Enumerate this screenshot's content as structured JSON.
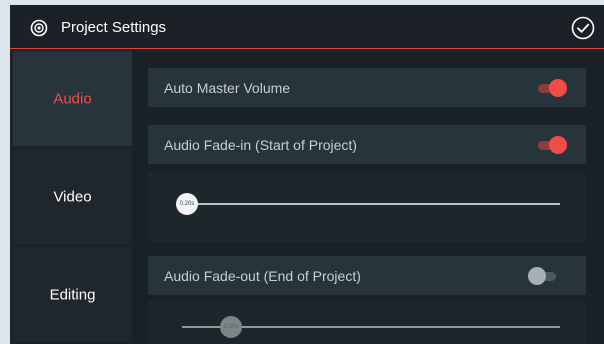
{
  "window": {
    "title": "Project Settings",
    "title_icon": "settings-ring-icon",
    "confirm_icon": "check-circle-icon"
  },
  "sidebar": {
    "items": [
      {
        "label": "Audio",
        "active": true
      },
      {
        "label": "Video",
        "active": false
      },
      {
        "label": "Editing",
        "active": false
      }
    ]
  },
  "settings": {
    "auto_master_volume": {
      "label": "Auto Master Volume",
      "enabled": true
    },
    "fade_in": {
      "label": "Audio Fade-in (Start of Project)",
      "enabled": true,
      "slider_value": "0.20s"
    },
    "fade_out": {
      "label": "Audio Fade-out (End of Project)",
      "enabled": false,
      "slider_value": "2.00s"
    }
  },
  "colors": {
    "accent": "#ef4f4a",
    "background": "#1d2429",
    "row": "#28343b"
  }
}
